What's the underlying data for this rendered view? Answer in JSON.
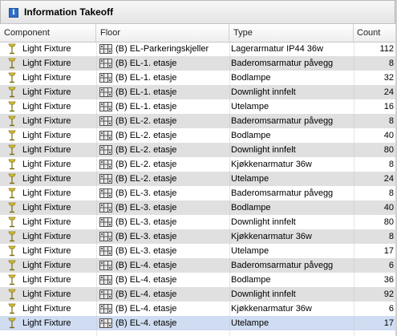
{
  "panel": {
    "title": "Information Takeoff"
  },
  "columns": {
    "component": "Component",
    "floor": "Floor",
    "type": "Type",
    "count": "Count"
  },
  "rows": [
    {
      "component": "Light Fixture",
      "floor": "(B) EL-Parkeringskjeller",
      "type": "Lagerarmatur IP44 36w",
      "count": "112"
    },
    {
      "component": "Light Fixture",
      "floor": "(B) EL-1. etasje",
      "type": "Baderomsarmatur påvegg",
      "count": "8"
    },
    {
      "component": "Light Fixture",
      "floor": "(B) EL-1. etasje",
      "type": "Bodlampe",
      "count": "32"
    },
    {
      "component": "Light Fixture",
      "floor": "(B) EL-1. etasje",
      "type": "Downlight innfelt",
      "count": "24"
    },
    {
      "component": "Light Fixture",
      "floor": "(B) EL-1. etasje",
      "type": "Utelampe",
      "count": "16"
    },
    {
      "component": "Light Fixture",
      "floor": "(B) EL-2. etasje",
      "type": "Baderomsarmatur påvegg",
      "count": "8"
    },
    {
      "component": "Light Fixture",
      "floor": "(B) EL-2. etasje",
      "type": "Bodlampe",
      "count": "40"
    },
    {
      "component": "Light Fixture",
      "floor": "(B) EL-2. etasje",
      "type": "Downlight innfelt",
      "count": "80"
    },
    {
      "component": "Light Fixture",
      "floor": "(B) EL-2. etasje",
      "type": "Kjøkkenarmatur 36w",
      "count": "8"
    },
    {
      "component": "Light Fixture",
      "floor": "(B) EL-2. etasje",
      "type": "Utelampe",
      "count": "24"
    },
    {
      "component": "Light Fixture",
      "floor": "(B) EL-3. etasje",
      "type": "Baderomsarmatur påvegg",
      "count": "8"
    },
    {
      "component": "Light Fixture",
      "floor": "(B) EL-3. etasje",
      "type": "Bodlampe",
      "count": "40"
    },
    {
      "component": "Light Fixture",
      "floor": "(B) EL-3. etasje",
      "type": "Downlight innfelt",
      "count": "80"
    },
    {
      "component": "Light Fixture",
      "floor": "(B) EL-3. etasje",
      "type": "Kjøkkenarmatur 36w",
      "count": "8"
    },
    {
      "component": "Light Fixture",
      "floor": "(B) EL-3. etasje",
      "type": "Utelampe",
      "count": "17"
    },
    {
      "component": "Light Fixture",
      "floor": "(B) EL-4. etasje",
      "type": "Baderomsarmatur påvegg",
      "count": "6"
    },
    {
      "component": "Light Fixture",
      "floor": "(B) EL-4. etasje",
      "type": "Bodlampe",
      "count": "36"
    },
    {
      "component": "Light Fixture",
      "floor": "(B) EL-4. etasje",
      "type": "Downlight innfelt",
      "count": "92"
    },
    {
      "component": "Light Fixture",
      "floor": "(B) EL-4. etasje",
      "type": "Kjøkkenarmatur 36w",
      "count": "6"
    },
    {
      "component": "Light Fixture",
      "floor": "(B) EL-4. etasje",
      "type": "Utelampe",
      "count": "17"
    }
  ],
  "selected_row": 19,
  "icons": {
    "title": "info-icon",
    "component": "light-fixture-icon",
    "floor": "floor-plan-icon"
  },
  "colors": {
    "shaded_row": "#e0e0e0",
    "selected_row": "#cfdcf1",
    "info_icon": "#2f6dc9"
  }
}
